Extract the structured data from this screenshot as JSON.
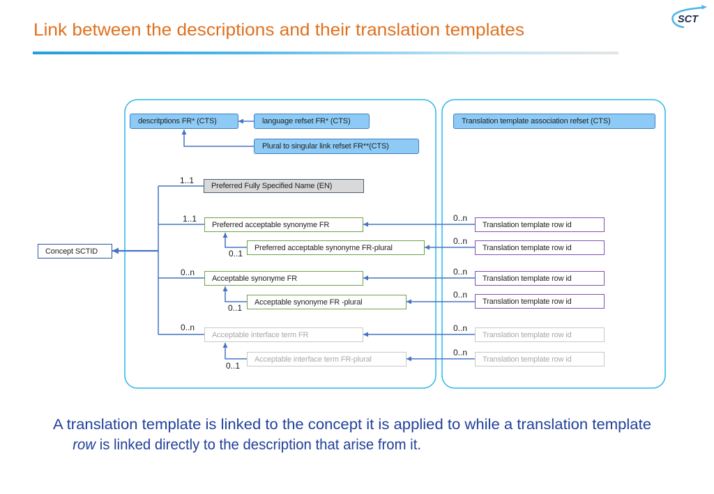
{
  "header": {
    "title": "Link between the descriptions and their translation templates",
    "logo_text": "SCT"
  },
  "diagram": {
    "refsets": {
      "descriptions": "descritptions FR* (CTS)",
      "language_refset": "language refset FR* (CTS)",
      "plural_link_refset": "Plural to singular link refset FR**(CTS)",
      "association_refset": "Translation template association refset (CTS)"
    },
    "concept": "Concept SCTID",
    "descriptions": [
      {
        "label": "Preferred Fully Specified Name (EN)",
        "cardinality": "1..1"
      },
      {
        "label": "Preferred acceptable synonyme FR",
        "cardinality": "1..1",
        "plural": {
          "label": "Preferred acceptable synonyme FR-plural",
          "cardinality": "0..1"
        }
      },
      {
        "label": "Acceptable synonyme FR",
        "cardinality": "0..n",
        "plural": {
          "label": "Acceptable synonyme FR -plural",
          "cardinality": "0..1"
        }
      },
      {
        "label": "Acceptable interface term FR",
        "cardinality": "0..n",
        "plural": {
          "label": "Acceptable interface term FR-plural",
          "cardinality": "0..1"
        }
      }
    ],
    "template_rows": [
      {
        "label": "Translation template row id",
        "cardinality": "0..n"
      },
      {
        "label": "Translation template row id",
        "cardinality": "0..n"
      },
      {
        "label": "Translation template row id",
        "cardinality": "0..n"
      },
      {
        "label": "Translation template row id",
        "cardinality": "0..n"
      },
      {
        "label": "Translation template row id",
        "cardinality": "0..n"
      },
      {
        "label": "Translation template row id",
        "cardinality": "0..n"
      }
    ]
  },
  "caption": {
    "line1": "A translation template is linked to the concept it is applied to while a translation template",
    "line2_italic": "row",
    "line2_rest": " is linked directly to the description that arise from it."
  },
  "colors": {
    "title": "#E0701E",
    "panel_border": "#29B6E6",
    "connector": "#4472C4",
    "refset_fill": "#8DCBF6",
    "description_border": "#6F9F4A",
    "template_row_border": "#7F4FB0",
    "inactive_border": "#C8C8C8",
    "caption": "#1F3F99"
  }
}
